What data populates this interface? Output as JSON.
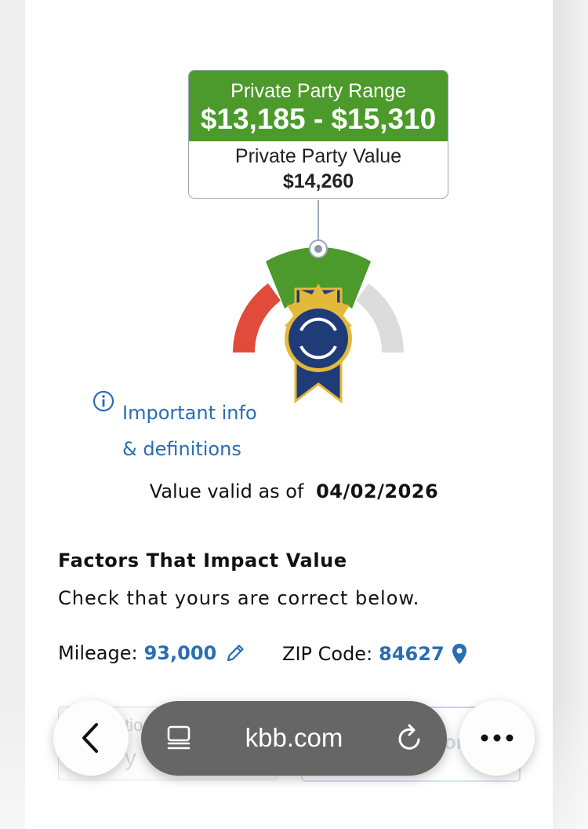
{
  "range_card": {
    "range_label": "Private Party Range",
    "range_value": "$13,185 - $15,310",
    "value_label": "Private Party Value",
    "value": "$14,260"
  },
  "gauge": {
    "segments": [
      "red",
      "green",
      "gray"
    ],
    "colors": {
      "low": "#e04b3c",
      "mid": "#4b9a2b",
      "high": "#dddddd",
      "badge_navy": "#1f3c78",
      "badge_gold": "#e3b93c"
    }
  },
  "info": {
    "line1": "Important info",
    "line2": "& definitions",
    "icon": "info-circle-icon"
  },
  "valid": {
    "label": "Value valid as of",
    "date": "04/02/2026"
  },
  "factors": {
    "title": "Factors That Impact Value",
    "subtitle": "Check that yours are correct below.",
    "mileage_label": "Mileage:",
    "mileage_value": "93,000",
    "zip_label": "ZIP Code:",
    "zip_value": "84627"
  },
  "obscured": {
    "left_fragment_top": "tio",
    "left_fragment_bottom": "y",
    "right_fragment": "or"
  },
  "browser": {
    "url": "kbb.com",
    "icons": [
      "back-chevron-icon",
      "tabs-icon",
      "reload-icon",
      "more-icon"
    ]
  },
  "colors": {
    "brand_green": "#4b9a2b",
    "link_blue": "#2a6db3",
    "pill_gray": "#666666"
  }
}
